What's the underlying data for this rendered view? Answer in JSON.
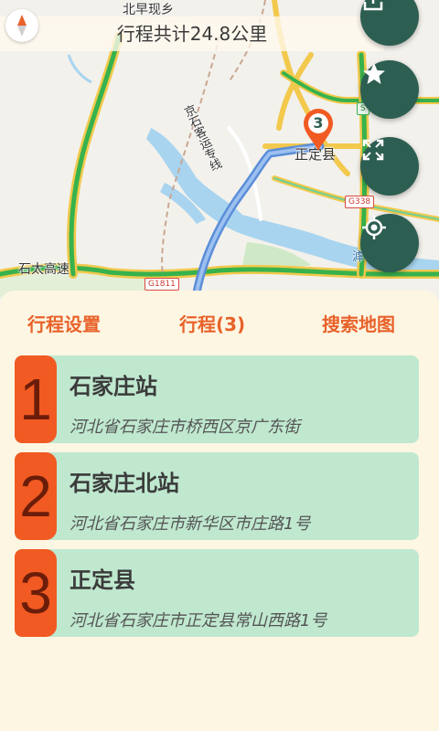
{
  "map": {
    "route_summary": "行程共计24.8公里",
    "labels": {
      "town_north": "北早现乡",
      "railway": "京石客运专线",
      "expressway": "石太高速",
      "county": "正定县",
      "river_partial": "滹"
    },
    "shields": {
      "g1811": "G1811",
      "g338": "G338",
      "s_partial": "S"
    },
    "marker_number": "3",
    "buttons": [
      "share-button",
      "favorite-button",
      "fullscreen-button",
      "locate-button"
    ]
  },
  "tabs": {
    "trip_settings": "行程设置",
    "trips": "行程(3)",
    "search_map": "搜索地图"
  },
  "stops": [
    {
      "number": "1",
      "name": "石家庄站",
      "address": "河北省石家庄市桥西区京广东街"
    },
    {
      "number": "2",
      "name": "石家庄北站",
      "address": "河北省石家庄市新华区市庄路1号"
    },
    {
      "number": "3",
      "name": "正定县",
      "address": "河北省石家庄市正定县常山西路1号"
    }
  ],
  "colors": {
    "accent": "#e8622a",
    "card_bg": "#bfe8cf",
    "badge_bg": "#f15a22",
    "fab_bg": "#2d5e52",
    "panel_bg": "#fdf6e3"
  }
}
